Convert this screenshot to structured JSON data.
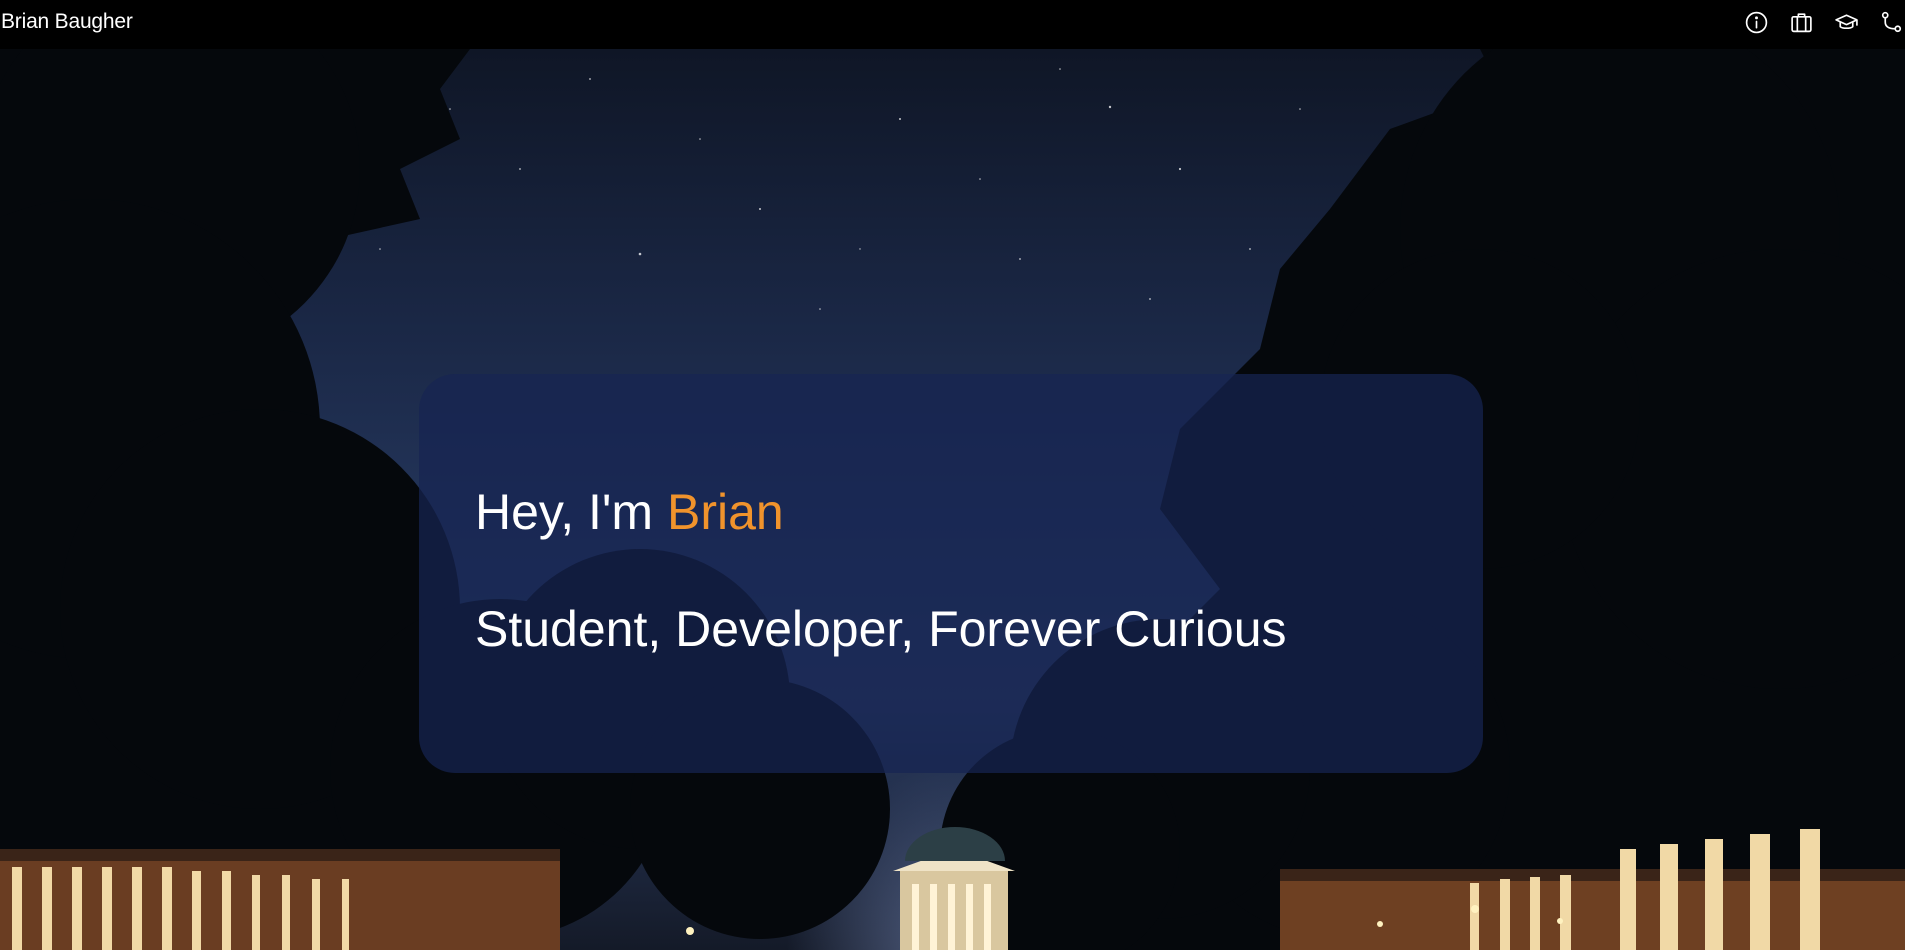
{
  "header": {
    "site_title": "Brian Baugher",
    "nav_icons": [
      {
        "icon": "info-icon"
      },
      {
        "icon": "briefcase-icon"
      },
      {
        "icon": "graduation-cap-icon"
      },
      {
        "icon": "git-branch-icon"
      }
    ]
  },
  "hero": {
    "greeting_prefix": "Hey, I'm ",
    "greeting_name": "Brian",
    "tagline": "Student, Developer, Forever Curious"
  },
  "colors": {
    "accent": "#f0932c",
    "card_background": "#162452",
    "header_background": "#000000",
    "text": "#ffffff"
  }
}
